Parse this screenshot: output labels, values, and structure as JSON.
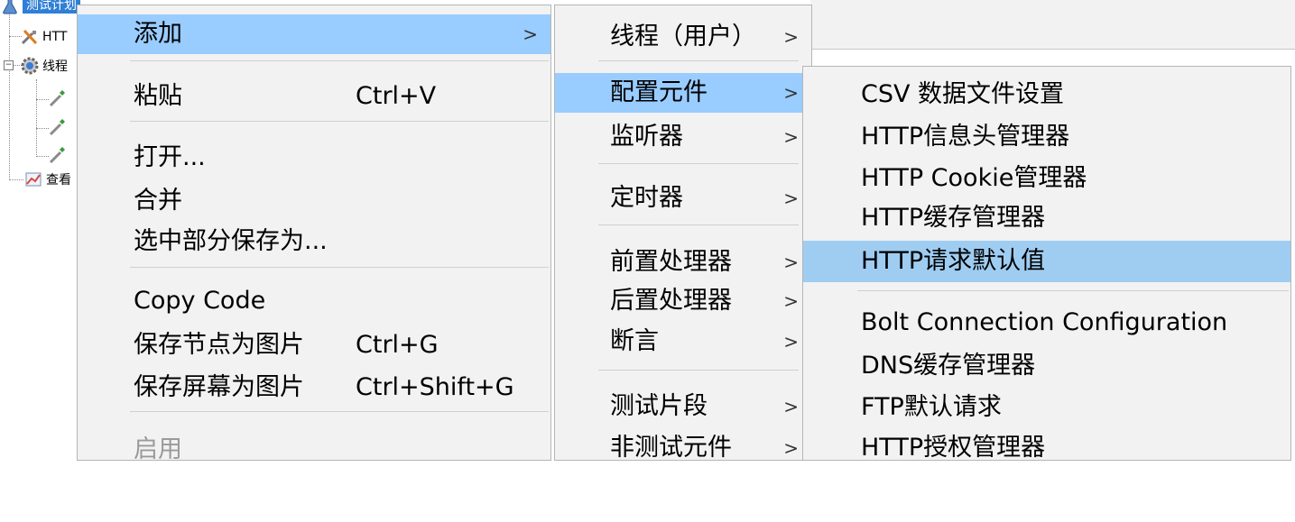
{
  "tree": {
    "root_label": "测试计划",
    "items": [
      {
        "label": "HTT",
        "icon": "wrench-icon"
      },
      {
        "label": "线程",
        "icon": "gear-icon",
        "expanded": true
      },
      {
        "label": "",
        "icon": "sampler-icon"
      },
      {
        "label": "",
        "icon": "sampler-icon"
      },
      {
        "label": "",
        "icon": "sampler-icon"
      },
      {
        "label": "查看",
        "icon": "listener-chart-icon"
      }
    ]
  },
  "context_menu": {
    "items": [
      {
        "label": "添加",
        "shortcut": "",
        "submenu": true,
        "highlighted": true
      },
      {
        "label": "粘贴",
        "shortcut": "Ctrl+V"
      },
      {
        "label": "打开...",
        "shortcut": ""
      },
      {
        "label": "合并",
        "shortcut": ""
      },
      {
        "label": "选中部分保存为...",
        "shortcut": ""
      },
      {
        "label": "Copy Code",
        "shortcut": ""
      },
      {
        "label": "保存节点为图片",
        "shortcut": "Ctrl+G"
      },
      {
        "label": "保存屏幕为图片",
        "shortcut": "Ctrl+Shift+G"
      },
      {
        "label": "启用",
        "shortcut": "",
        "disabled": true
      }
    ]
  },
  "add_submenu": {
    "items": [
      {
        "label": "线程（用户）",
        "submenu": true
      },
      {
        "label": "配置元件",
        "submenu": true,
        "highlighted": true
      },
      {
        "label": "监听器",
        "submenu": true
      },
      {
        "label": "定时器",
        "submenu": true
      },
      {
        "label": "前置处理器",
        "submenu": true
      },
      {
        "label": "后置处理器",
        "submenu": true
      },
      {
        "label": "断言",
        "submenu": true
      },
      {
        "label": "测试片段",
        "submenu": true
      },
      {
        "label": "非测试元件",
        "submenu": true
      }
    ]
  },
  "config_submenu": {
    "items": [
      {
        "label": "CSV 数据文件设置"
      },
      {
        "label": "HTTP信息头管理器"
      },
      {
        "label": "HTTP Cookie管理器"
      },
      {
        "label": "HTTP缓存管理器"
      },
      {
        "label": "HTTP请求默认值",
        "highlighted": true
      },
      {
        "label": "Bolt Connection Configuration"
      },
      {
        "label": "DNS缓存管理器"
      },
      {
        "label": "FTP默认请求"
      },
      {
        "label": "HTTP授权管理器"
      }
    ]
  },
  "arrow_glyph": ">",
  "colors": {
    "menu_highlight": "#99ccff",
    "tree_selection": "#2f7fd6",
    "menu_background": "#f2f2f2",
    "disabled_text": "#9a9a9a"
  }
}
